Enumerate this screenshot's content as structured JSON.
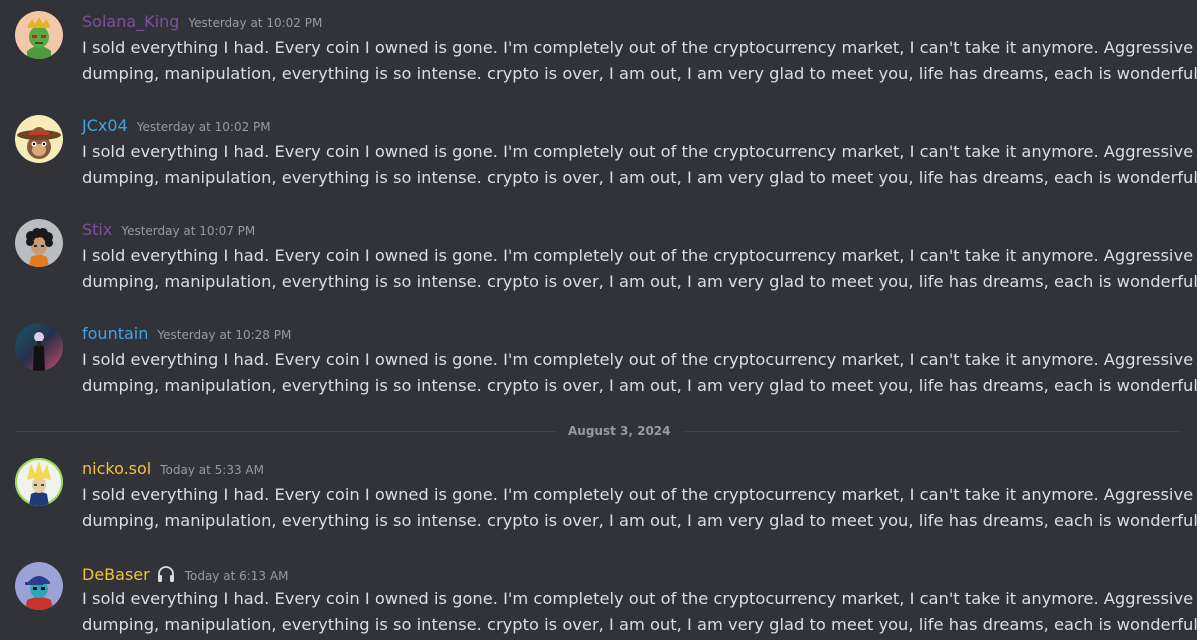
{
  "messages_before": [
    {
      "username": "Solana_King",
      "username_color": "#7a4fa3",
      "timestamp": "Yesterday at 10:02 PM",
      "line1": "I sold everything I had. Every coin I owned is gone. I'm completely out of the cryptocurrency market, I can't take it anymore. Aggressive",
      "line2": "dumping, manipulation, everything is so intense. crypto is over, I am out, I am very glad to meet you, life has dreams, each is wonderful.",
      "avatar_icon": "crowned-frog-avatar-icon"
    },
    {
      "username": "JCx04",
      "username_color": "#3ba7e6",
      "timestamp": "Yesterday at 10:02 PM",
      "line1": "I sold everything I had. Every coin I owned is gone. I'm completely out of the cryptocurrency market, I can't take it anymore. Aggressive",
      "line2": "dumping, manipulation, everything is so intense. crypto is over, I am out, I am very glad to meet you, life has dreams, each is wonderful.",
      "avatar_icon": "sombrero-monkey-avatar-icon"
    },
    {
      "username": "Stix",
      "username_color": "#7a4fa3",
      "timestamp": "Yesterday at 10:07 PM",
      "line1": "I sold everything I had. Every coin I owned is gone. I'm completely out of the cryptocurrency market, I can't take it anymore. Aggressive",
      "line2": "dumping, manipulation, everything is so intense. crypto is over, I am out, I am very glad to meet you, life has dreams, each is wonderful.",
      "avatar_icon": "curly-hair-character-avatar-icon"
    },
    {
      "username": "fountain",
      "username_color": "#3ba7e6",
      "timestamp": "Yesterday at 10:28 PM",
      "line1": "I sold everything I had. Every coin I owned is gone. I'm completely out of the cryptocurrency market, I can't take it anymore. Aggressive",
      "line2": "dumping, manipulation, everything is so intense. crypto is over, I am out, I am very glad to meet you, life has dreams, each is wonderful.",
      "avatar_icon": "dark-figure-avatar-icon"
    }
  ],
  "date_divider": "August 3, 2024",
  "messages_after": [
    {
      "username": "nicko.sol",
      "username_color": "#f0c239",
      "timestamp": "Today at 5:33 AM",
      "line1": "I sold everything I had. Every coin I owned is gone. I'm completely out of the cryptocurrency market, I can't take it anymore. Aggressive",
      "line2": "dumping, manipulation, everything is so intense. crypto is over, I am out, I am very glad to meet you, life has dreams, each is wonderful.",
      "avatar_icon": "anime-spiky-hair-avatar-icon"
    },
    {
      "username": "DeBaser",
      "username_color": "#f0c239",
      "timestamp": "Today at 6:13 AM",
      "line1": "I sold everything I had. Every coin I owned is gone. I'm completely out of the cryptocurrency market, I can't take it anymore. Aggressive",
      "line2": "dumping, manipulation, everything is so intense. crypto is over, I am out, I am very glad to meet you, life has dreams, each is wonderful.",
      "avatar_icon": "capped-character-avatar-icon",
      "has_headphones_badge": true
    }
  ]
}
